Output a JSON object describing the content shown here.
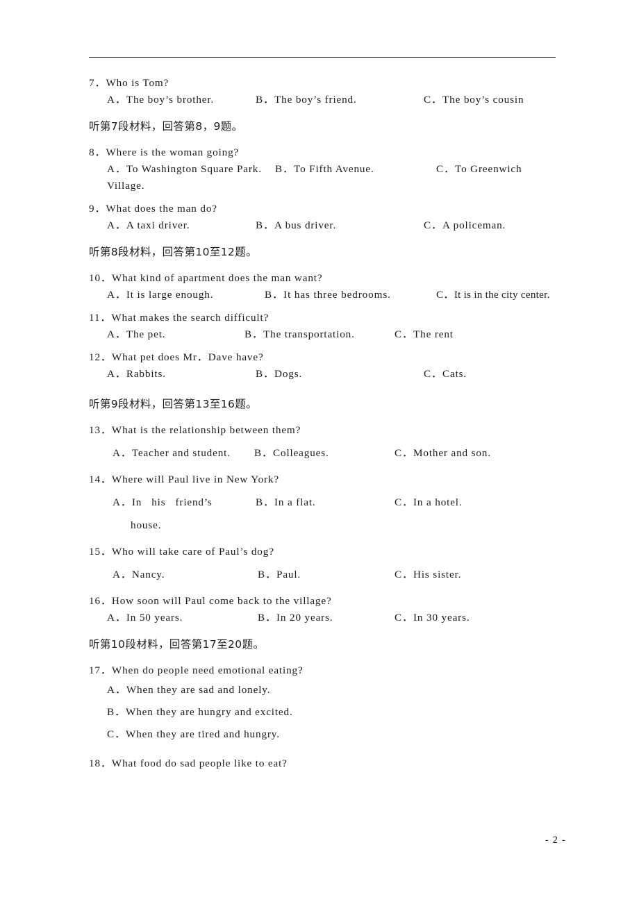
{
  "page": {
    "footer_label": "- 2 -",
    "header_rule": true
  },
  "sections": {
    "s7": {
      "question": "7．Who is Tom?",
      "options": {
        "a": "A．The boy’s brother.",
        "b": "B．The boy’s friend.",
        "c": "C．The boy’s cousin"
      }
    },
    "cn7": "听第7段材料，回答第8，9题。",
    "s8": {
      "question": "8．Where is the woman going?",
      "options": {
        "a": "A．To Washington Square Park.",
        "b": "B．To Fifth Avenue.",
        "c": "C．To Greenwich"
      },
      "cont": "Village."
    },
    "s9": {
      "question": "9．What does the man do?",
      "options": {
        "a": "A．A taxi driver.",
        "b": "B．A bus driver.",
        "c": "C．A policeman."
      }
    },
    "cn8": "听第8段材料，回答第10至12题。",
    "s10": {
      "question": "10．What kind of apartment does the man want?",
      "options": {
        "a": "A．It is large enough.",
        "b": "B．It has three bedrooms.",
        "c": "C．It is in the city center."
      }
    },
    "s11": {
      "question": "11．What makes the search difficult?",
      "options": {
        "a": "A．The pet.",
        "b": "B．The transportation.",
        "c": "C．The rent"
      }
    },
    "s12": {
      "question": "12．What pet does Mr．Dave have?",
      "options": {
        "a": "A．Rabbits.",
        "b": "B．Dogs.",
        "c": "C．Cats."
      }
    },
    "cn9": "听第9段材料，回答第13至16题。",
    "s13": {
      "question": "13．What is the relationship between them?",
      "options": {
        "a": "A．Teacher and student.",
        "b": "B．Colleagues.",
        "c": "C．Mother and son."
      }
    },
    "s14": {
      "question": "14．Where will Paul live in New York?",
      "options": {
        "a_1": "A．In",
        "a_2": "his",
        "a_3": "friend’s",
        "b": "B．In a flat.",
        "c": "C．In a hotel."
      },
      "cont": "house."
    },
    "s15": {
      "question": "15．Who will take care of Paul’s dog?",
      "options": {
        "a": "A．Nancy.",
        "b": "B．Paul.",
        "c": "C．His sister."
      }
    },
    "s16": {
      "question": "16．How soon will Paul come back to the village?",
      "options": {
        "a": "A．In 50 years.",
        "b": "B．In 20 years.",
        "c": "C．In 30 years."
      }
    },
    "cn10": "听第10段材料，回答第17至20题。",
    "s17": {
      "question": "17．When do people need emotional eating?",
      "options": {
        "a": "A．When they are sad and lonely.",
        "b": "B．When they are hungry and excited.",
        "c": "C．When they are tired and hungry."
      }
    },
    "s18": {
      "question": "18．What food do sad people like to eat?"
    }
  }
}
